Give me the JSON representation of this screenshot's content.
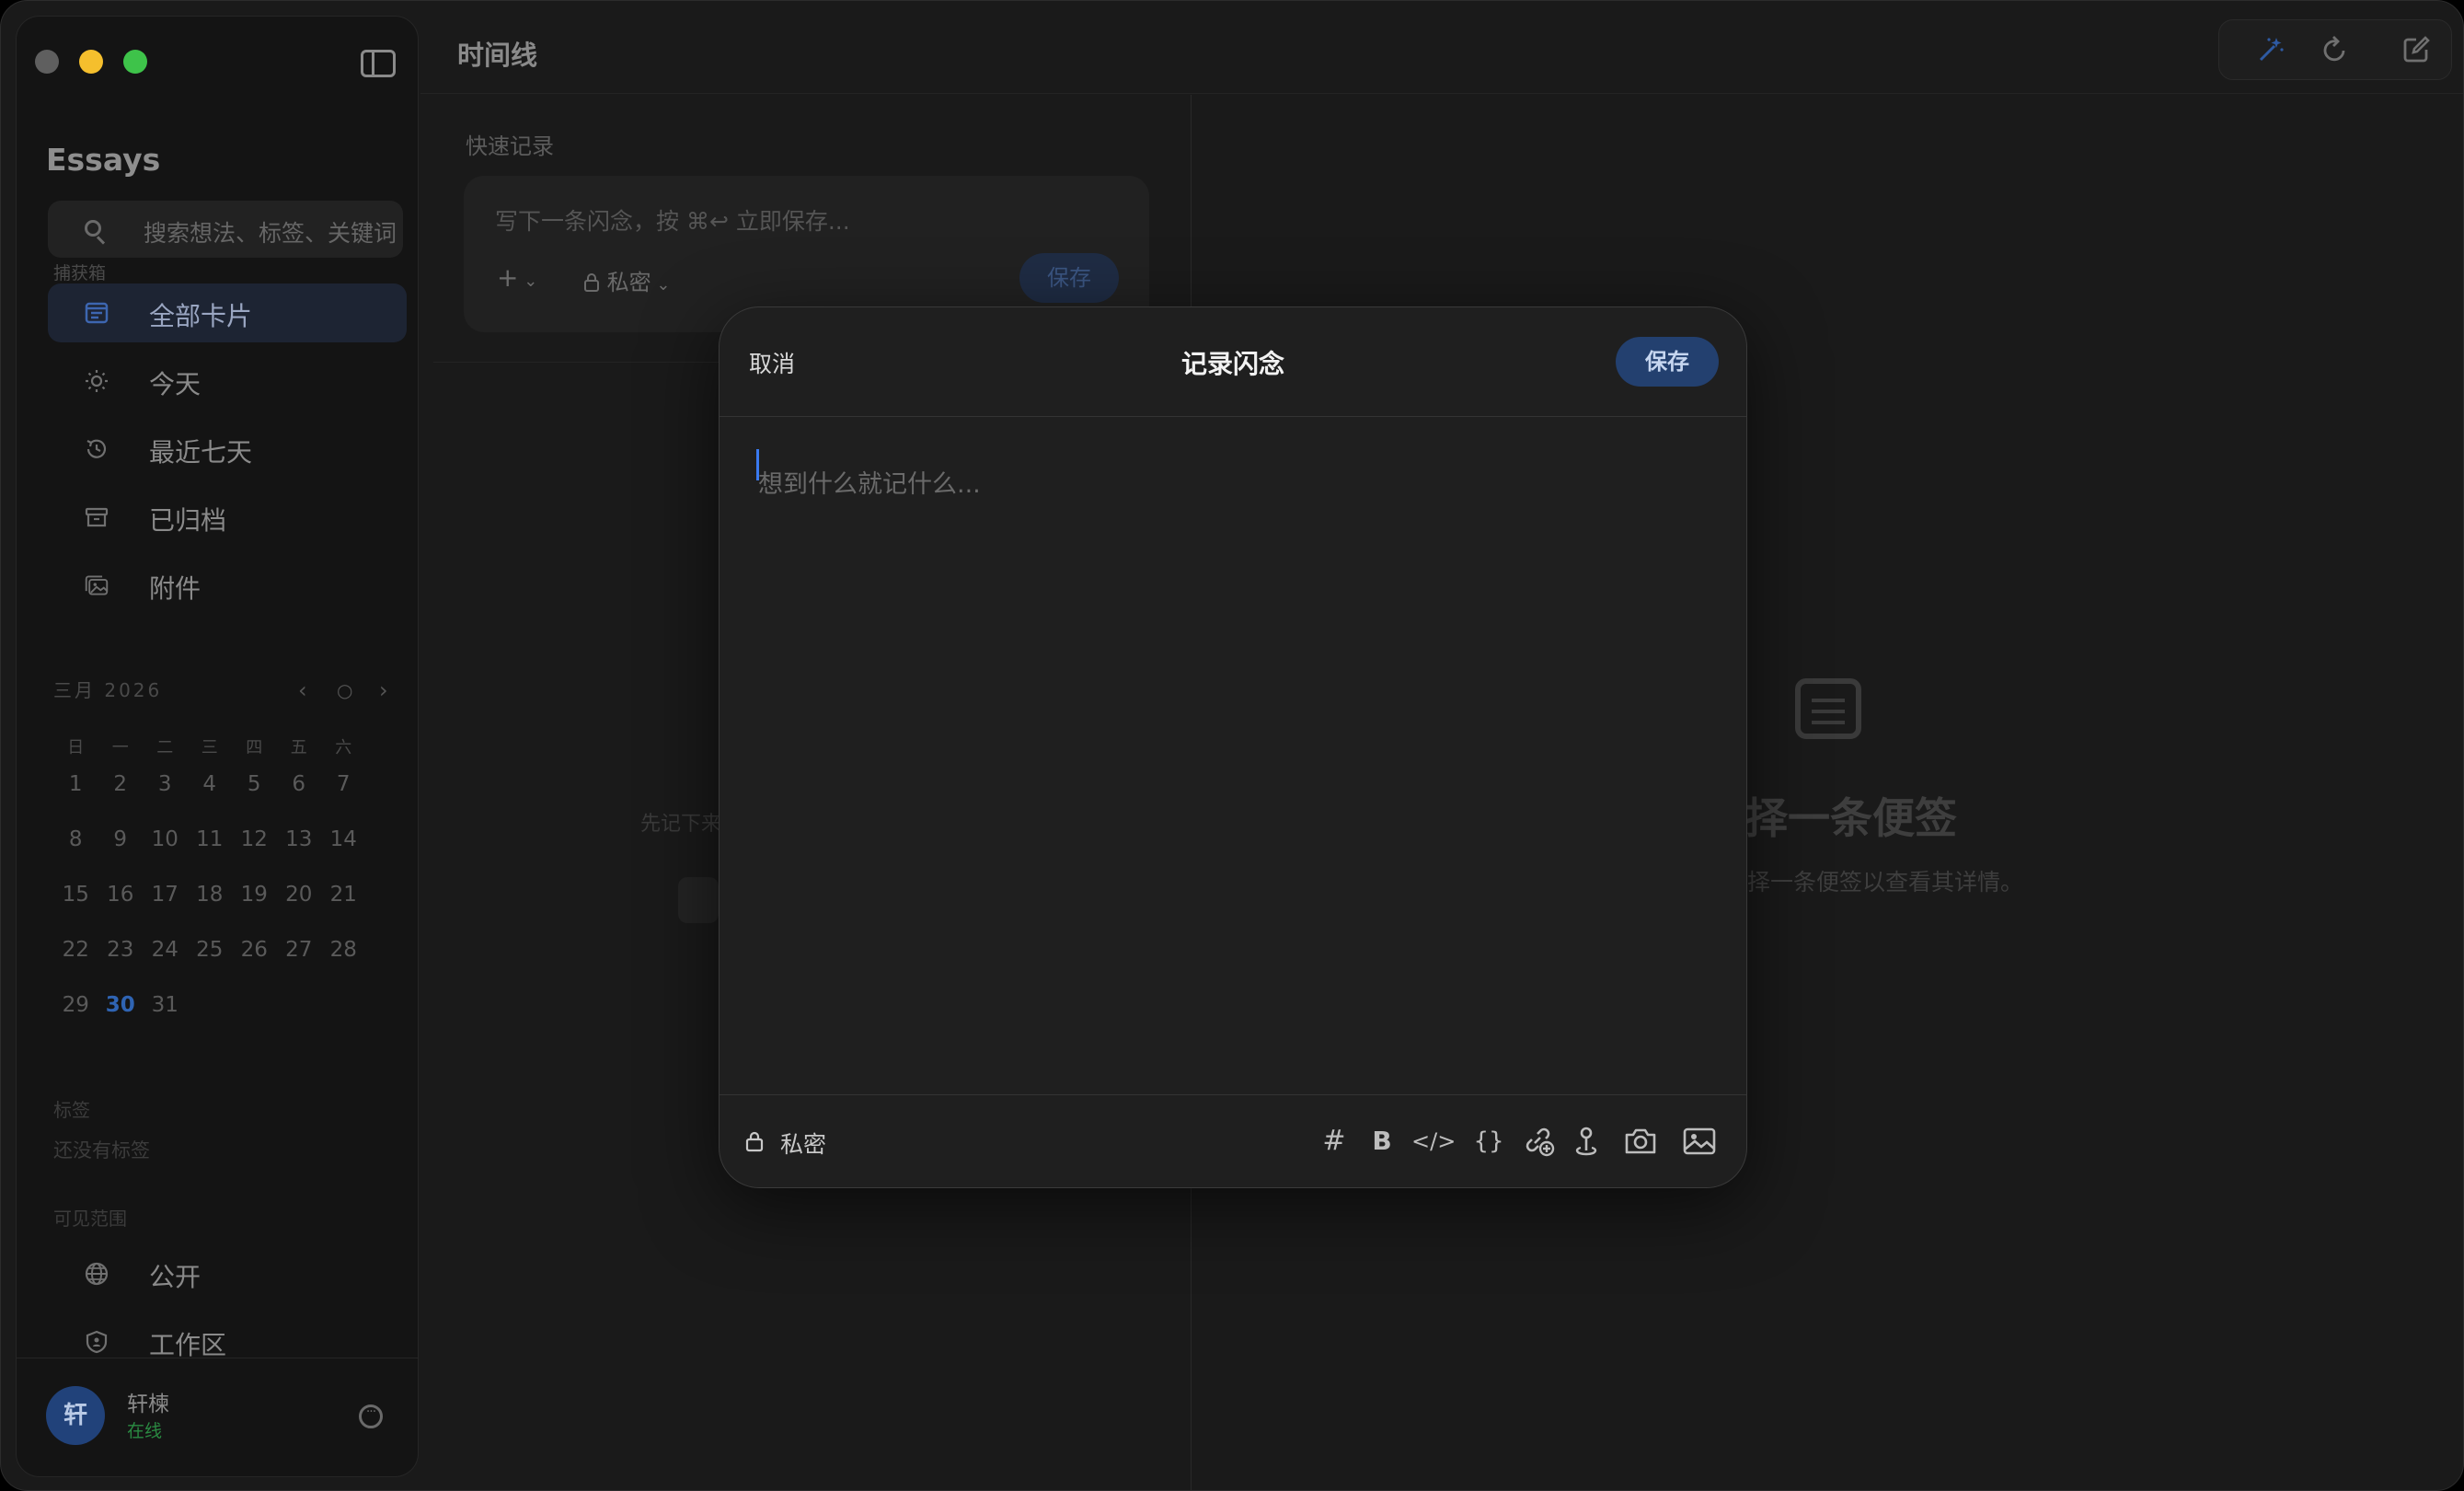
{
  "window": {
    "traffic_colors": [
      "#5f5f5f",
      "#f5bf2d",
      "#3ec34a"
    ]
  },
  "sidebar": {
    "app_title": "Essays",
    "search_placeholder": "搜索想法、标签、关键词",
    "capture_label": "捕获箱",
    "nav": [
      {
        "label": "全部卡片",
        "icon": "cards-icon",
        "active": true
      },
      {
        "label": "今天",
        "icon": "sun-icon",
        "active": false
      },
      {
        "label": "最近七天",
        "icon": "history-icon",
        "active": false
      },
      {
        "label": "已归档",
        "icon": "archive-icon",
        "active": false
      },
      {
        "label": "附件",
        "icon": "attachments-icon",
        "active": false
      }
    ],
    "calendar": {
      "month": "三月 2026",
      "weekdays": [
        "日",
        "一",
        "二",
        "三",
        "四",
        "五",
        "六"
      ],
      "days": [
        "1",
        "2",
        "3",
        "4",
        "5",
        "6",
        "7",
        "8",
        "9",
        "10",
        "11",
        "12",
        "13",
        "14",
        "15",
        "16",
        "17",
        "18",
        "19",
        "20",
        "21",
        "22",
        "23",
        "24",
        "25",
        "26",
        "27",
        "28",
        "29",
        "30",
        "31"
      ],
      "today": "30"
    },
    "tags_label": "标签",
    "no_tags": "还没有标签",
    "visibility_label": "可见范围",
    "visibility": [
      {
        "label": "公开",
        "icon": "globe-icon"
      },
      {
        "label": "工作区",
        "icon": "shield-icon"
      }
    ],
    "user": {
      "avatar_text": "轩",
      "name": "轩楝",
      "status": "在线"
    }
  },
  "header": {
    "title": "时间线",
    "icons": [
      "magic-wand-icon",
      "refresh-icon",
      "compose-icon"
    ]
  },
  "quick": {
    "label": "快速记录",
    "placeholder": "写下一条闪念，按 ⌘↩ 立即保存...",
    "plus": "+",
    "privacy": "私密",
    "save": "保存"
  },
  "middle_empty": {
    "text": "先记下来"
  },
  "right_empty": {
    "title": "择一条便签",
    "subtitle": "择一条便签以查看其详情。"
  },
  "modal": {
    "cancel": "取消",
    "title": "记录闪念",
    "save": "保存",
    "placeholder": "想到什么就记什么...",
    "privacy": "私密",
    "toolbar": [
      {
        "name": "hashtag-icon",
        "glyph": "#"
      },
      {
        "name": "bold-icon",
        "glyph": "B"
      },
      {
        "name": "code-icon",
        "glyph": "</>"
      },
      {
        "name": "code-block-icon",
        "glyph": "{}"
      },
      {
        "name": "link-add-icon",
        "glyph": ""
      },
      {
        "name": "location-pin-icon",
        "glyph": ""
      },
      {
        "name": "camera-icon",
        "glyph": ""
      },
      {
        "name": "image-icon",
        "glyph": ""
      }
    ]
  }
}
